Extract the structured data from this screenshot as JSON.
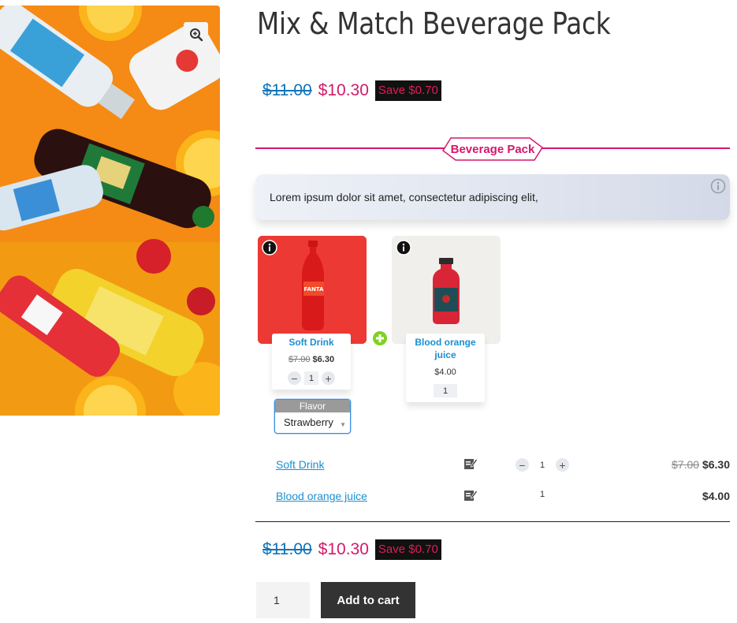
{
  "product": {
    "title": "Mix & Match Beverage Pack",
    "price_old": "$11.00",
    "price_new": "$10.30",
    "save": "Save $0.70"
  },
  "section": {
    "title": "Beverage Pack",
    "description": "Lorem ipsum dolor sit amet, consectetur adipiscing elit,"
  },
  "items": [
    {
      "name": "Soft Drink",
      "price_old": "$7.00",
      "price_new": "$6.30",
      "qty": "1",
      "flavor_label": "Flavor",
      "flavor_value": "Strawberry"
    },
    {
      "name": "Blood orange juice",
      "price": "$4.00",
      "qty": "1"
    }
  ],
  "summary": [
    {
      "name": "Soft Drink",
      "qty": "1",
      "price_old": "$7.00",
      "price_new": "$6.30"
    },
    {
      "name": "Blood orange juice",
      "qty": "1",
      "price": "$4.00"
    }
  ],
  "total": {
    "price_old": "$11.00",
    "price_new": "$10.30",
    "save": "Save $0.70"
  },
  "cart": {
    "qty": "1",
    "button_label": "Add to cart"
  },
  "colors": {
    "accent": "#d6166e",
    "link": "#1b8fd1",
    "save_text": "#e01d56"
  }
}
